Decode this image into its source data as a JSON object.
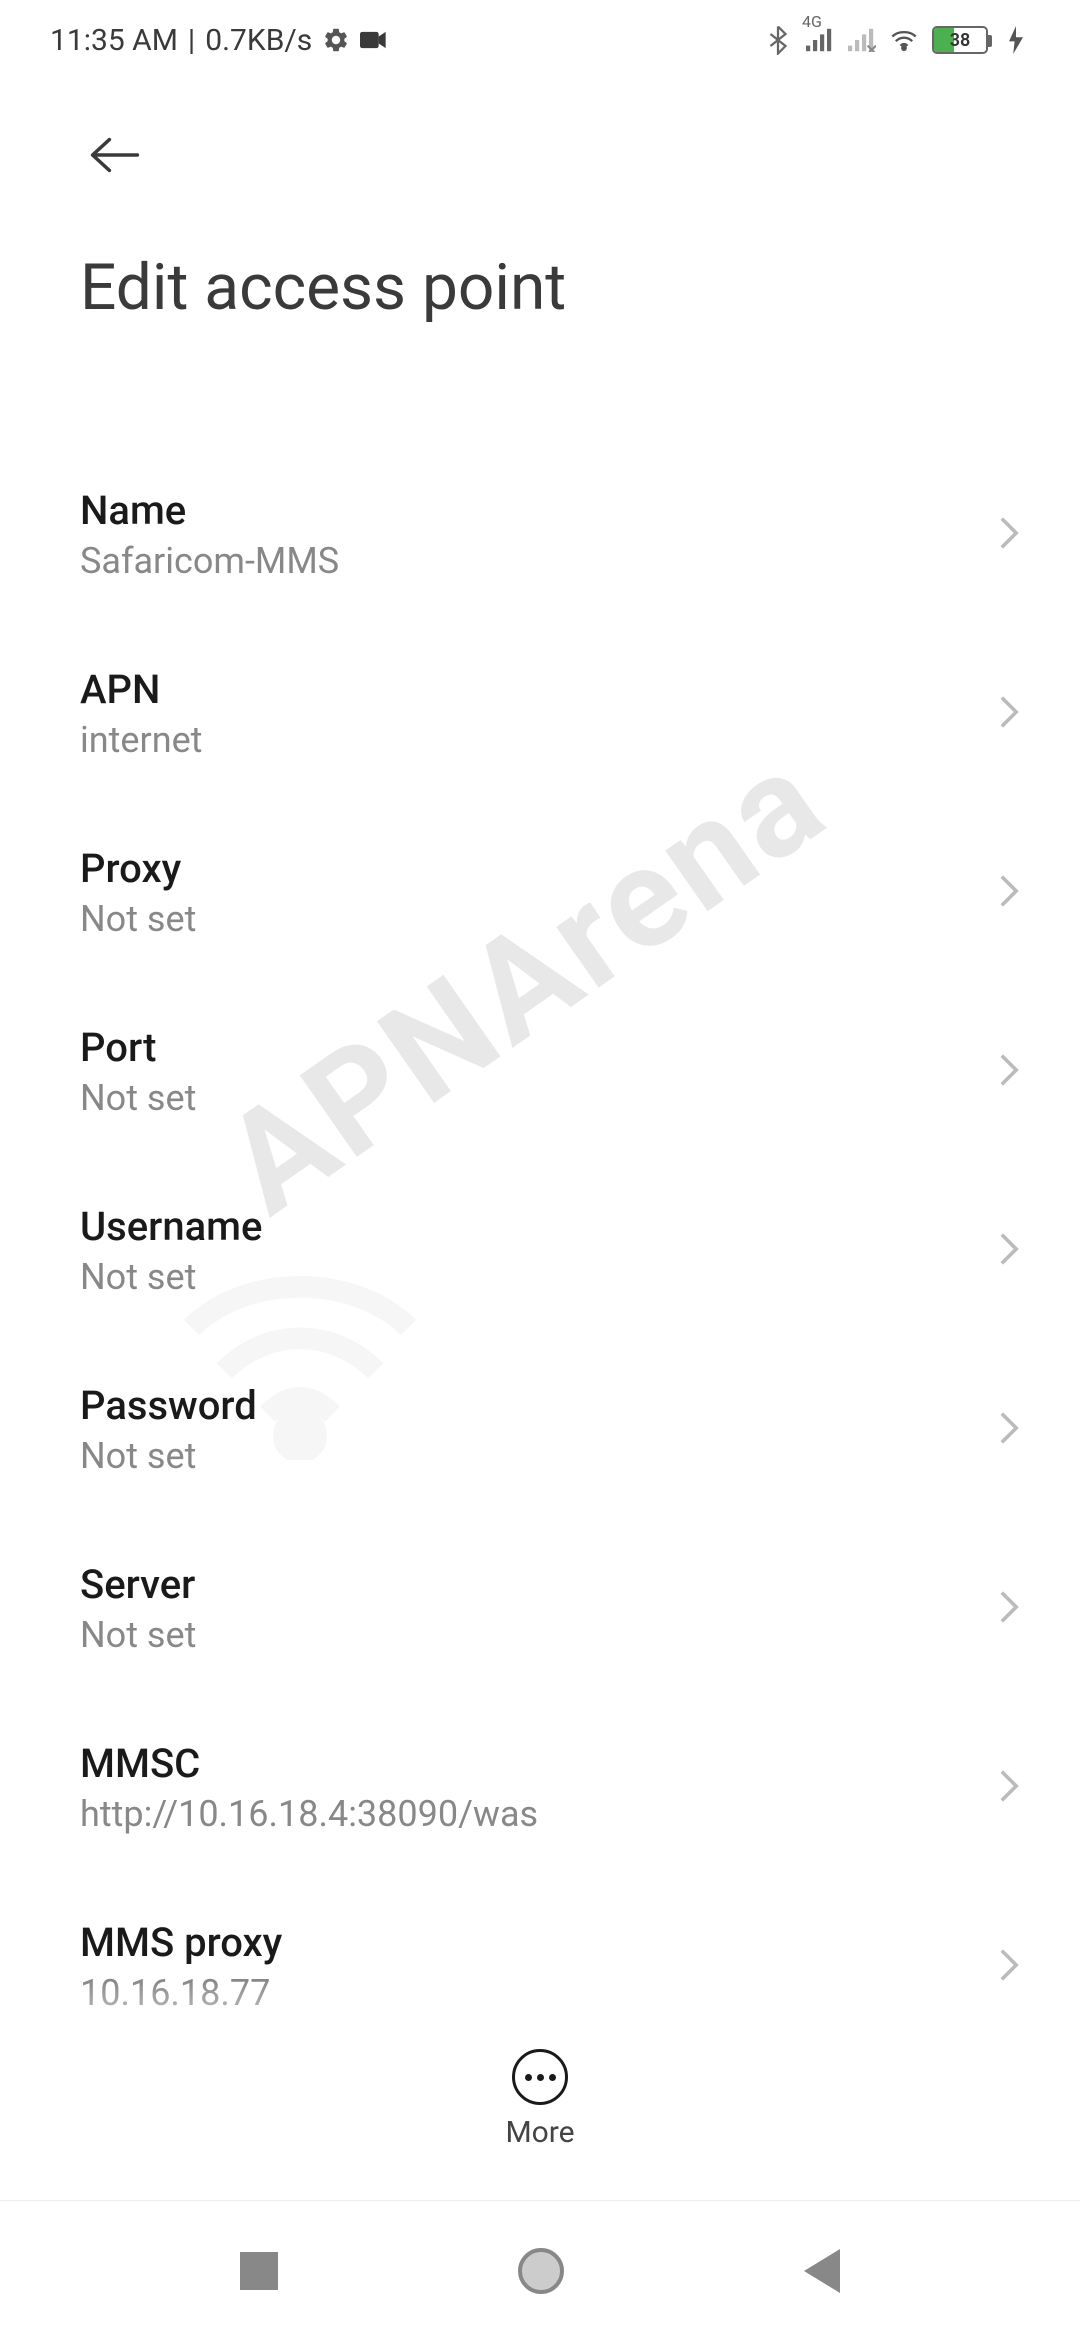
{
  "status": {
    "time": "11:35 AM",
    "net_speed": "0.7KB/s",
    "network_badge": "4G",
    "battery_pct": "38"
  },
  "page": {
    "title": "Edit access point"
  },
  "settings": [
    {
      "label": "Name",
      "value": "Safaricom-MMS"
    },
    {
      "label": "APN",
      "value": "internet"
    },
    {
      "label": "Proxy",
      "value": "Not set"
    },
    {
      "label": "Port",
      "value": "Not set"
    },
    {
      "label": "Username",
      "value": "Not set"
    },
    {
      "label": "Password",
      "value": "Not set"
    },
    {
      "label": "Server",
      "value": "Not set"
    },
    {
      "label": "MMSC",
      "value": "http://10.16.18.4:38090/was"
    },
    {
      "label": "MMS proxy",
      "value": "10.16.18.77"
    }
  ],
  "bottom": {
    "more_label": "More"
  },
  "watermark": "APNArena"
}
